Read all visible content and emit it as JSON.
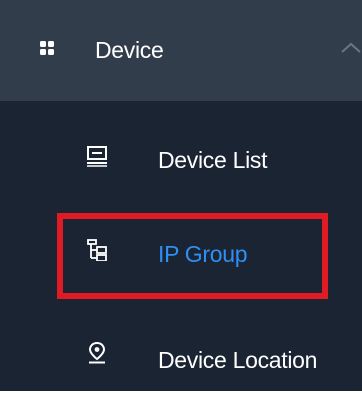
{
  "menu": {
    "group": {
      "label": "Device",
      "icon": "grid-icon",
      "expanded": true
    },
    "items": [
      {
        "label": "Device List",
        "icon": "monitor-icon",
        "active": false
      },
      {
        "label": "IP Group",
        "icon": "tree-icon",
        "active": true
      },
      {
        "label": "Device Location",
        "icon": "location-pin-icon",
        "active": false
      }
    ]
  },
  "annotation": {
    "highlight_color": "#e01b24"
  },
  "colors": {
    "sidebar_bg": "#1b2433",
    "group_header_bg": "#323d4c",
    "text": "#ffffff",
    "active_text": "#2f8ff2"
  }
}
